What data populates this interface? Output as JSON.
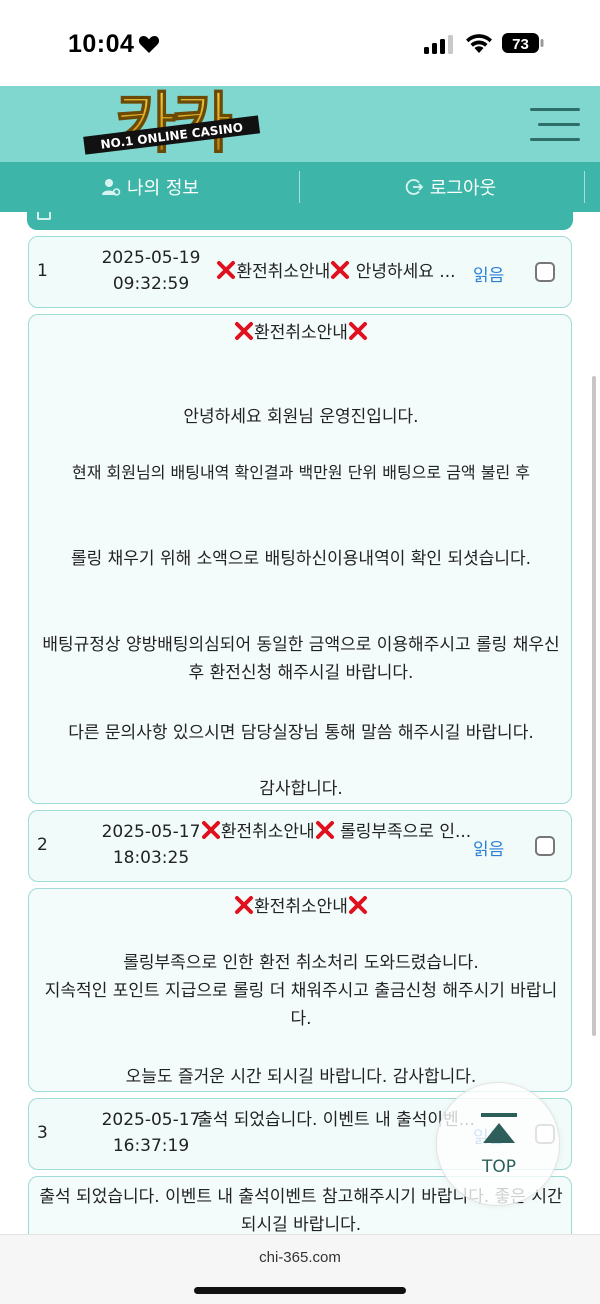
{
  "status": {
    "time": "10:04",
    "battery": "73"
  },
  "header": {
    "logo_text": "카카",
    "logo_tagline": "NO.1 ONLINE CASINO"
  },
  "nav": {
    "my_info": "나의 정보",
    "logout": "로그아웃"
  },
  "messages": [
    {
      "num": "1",
      "date": "2025-05-19",
      "time": "09:32:59",
      "subject": "환전취소안내",
      "subject_preview": " 안녕하세요 ...",
      "status": "읽음",
      "detail_title": "환전취소안내",
      "detail_lines": [
        "안녕하세요 회원님 운영진입니다.",
        "현재 회원님의 배팅내역 확인결과 백만원 단위 배팅으로 금액 불린 후",
        "롤링 채우기 위해 소액으로 배팅하신이용내역이 확인 되셧습니다.",
        "배팅규정상 양방배팅의심되어 동일한 금액으로 이용해주시고 롤링 채우신 후 환전신청 해주시길 바랍니다.",
        "다른 문의사항 있으시면 담당실장님 통해 말씀 해주시길 바랍니다.",
        "감사합니다."
      ]
    },
    {
      "num": "2",
      "date": "2025-05-17",
      "time": "18:03:25",
      "subject": "환전취소안내",
      "subject_preview": " 롤링부족으로 인...",
      "status": "읽음",
      "detail_title": "환전취소안내",
      "detail_lines": [
        "롤링부족으로 인한 환전 취소처리 도와드렸습니다.",
        "지속적인 포인트 지급으로 롤링 더 채워주시고 출금신청 해주시기 바랍니다.",
        "오늘도 즐거운 시간 되시길 바랍니다. 감사합니다."
      ]
    },
    {
      "num": "3",
      "date": "2025-05-17",
      "time": "16:37:19",
      "subject_preview": "출석 되었습니다. 이벤트 내 출석이벤...",
      "status": "읽음",
      "detail_lines": [
        "출석 되었습니다. 이벤트 내 출석이벤트 참고해주시기 바랍니다. 좋은 시간 되시길 바랍니다."
      ]
    }
  ],
  "top_button": "TOP",
  "browser": {
    "url": "chi-365.com"
  },
  "colors": {
    "header_bg": "#7fd7d0",
    "nav_bg": "#3db6a9",
    "read_status": "#2a7fd4",
    "xmark": "#e0101e"
  }
}
